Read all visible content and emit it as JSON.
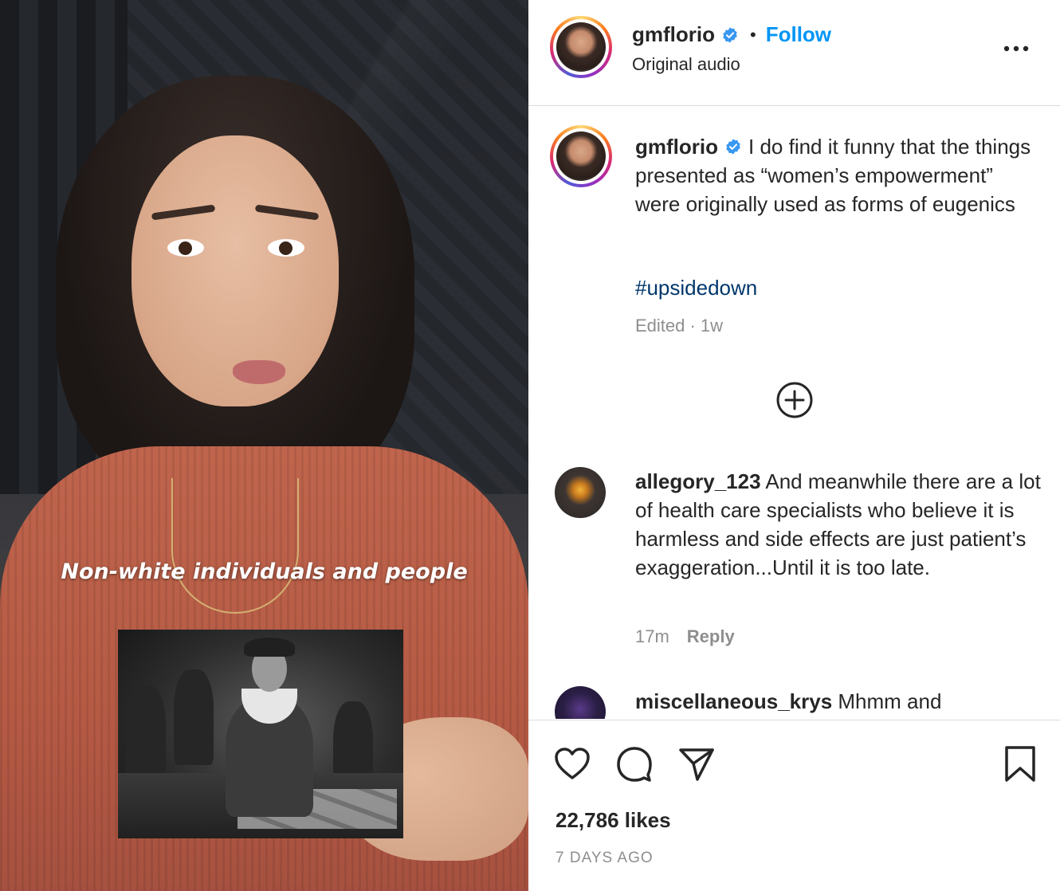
{
  "video": {
    "overlay_caption": "Non-white individuals and people"
  },
  "header": {
    "username": "gmflorio",
    "verified": true,
    "separator": "•",
    "follow_label": "Follow",
    "audio_label": "Original audio",
    "more_icon": "more-horizontal-icon"
  },
  "caption": {
    "username": "gmflorio",
    "text": "I do find it funny that the things presented as “women’s empowerment” were originally used as forms of eugenics",
    "hashtag": "#upsidedown",
    "meta": "Edited · 1w"
  },
  "load_more_icon": "plus-circle-icon",
  "comments": [
    {
      "username": "allegory_123",
      "text": "And meanwhile there are a lot of health care specialists who believe it is harmless and side effects are just patient’s exaggeration...Until it is too late.",
      "time": "17m",
      "reply_label": "Reply"
    },
    {
      "username": "miscellaneous_krys",
      "text": "Mhmm and"
    }
  ],
  "actions": {
    "like_icon": "heart-icon",
    "comment_icon": "comment-icon",
    "share_icon": "share-icon",
    "save_icon": "bookmark-icon",
    "likes_text": "22,786 likes",
    "date_text": "7 DAYS AGO"
  },
  "colors": {
    "link_blue": "#0095f6",
    "hashtag_blue": "#00376b",
    "muted": "#8e8e8e",
    "text": "#262626",
    "divider": "#dbdbdb"
  }
}
